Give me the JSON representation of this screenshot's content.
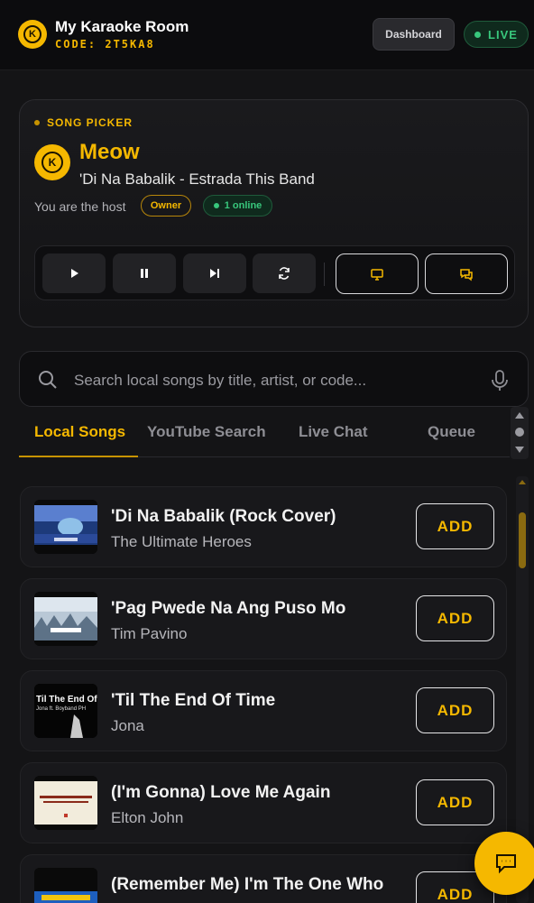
{
  "header": {
    "title": "My Karaoke Room",
    "code": "CODE: 2T5KA8",
    "logo_letter": "K",
    "dashboard_label": "Dashboard",
    "live_label": "LIVE"
  },
  "picker": {
    "section_label": "SONG PICKER",
    "avatar_letter": "K",
    "singer_name": "Meow",
    "current_song": "'Di Na Babalik - Estrada This Band",
    "host_text": "You are the host",
    "owner_badge": "Owner",
    "online_badge": "1 online",
    "controls": [
      "play-icon",
      "pause-icon",
      "skip-next-icon",
      "refresh-icon",
      "monitor-icon",
      "chat-icon"
    ]
  },
  "search": {
    "placeholder": "Search local songs by title, artist, or code..."
  },
  "tabs": [
    {
      "label": "Local Songs",
      "active": true
    },
    {
      "label": "YouTube Search",
      "active": false
    },
    {
      "label": "Live Chat",
      "active": false
    },
    {
      "label": "Queue",
      "active": false
    }
  ],
  "songs": [
    {
      "title": "'Di Na Babalik (Rock Cover)",
      "artist": "The Ultimate Heroes",
      "add_label": "ADD"
    },
    {
      "title": "'Pag Pwede Na Ang Puso Mo",
      "artist": "Tim Pavino",
      "add_label": "ADD"
    },
    {
      "title": "'Til The End Of Time",
      "artist": "Jona",
      "add_label": "ADD"
    },
    {
      "title": "(I'm Gonna) Love Me Again",
      "artist": "Elton John",
      "add_label": "ADD"
    },
    {
      "title": "(Remember Me) I'm The One Who",
      "artist": "",
      "add_label": "ADD"
    }
  ],
  "thumbnail_text": {
    "song3": "Til The End Of Tim",
    "song3_sub": "Jona ft. Boyband PH"
  },
  "colors": {
    "accent": "#f5b800",
    "live_green": "#38c77c",
    "background": "#141416"
  }
}
